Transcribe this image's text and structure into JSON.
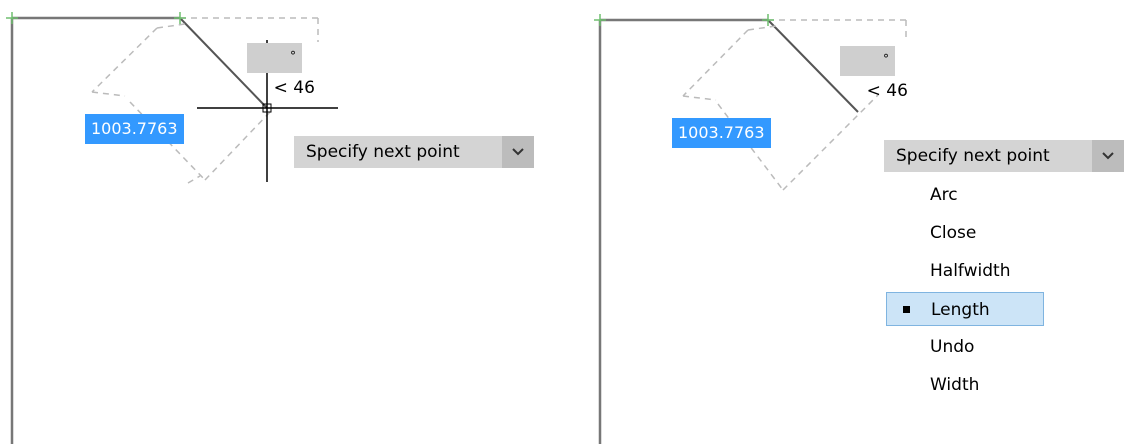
{
  "left_panel": {
    "angle_value": "< 46",
    "degree_symbol": "°",
    "distance_value": "1003.7763",
    "prompt_text": "Specify next point",
    "dropdown_icon": "chevron-down-icon"
  },
  "right_panel": {
    "angle_value": "< 46",
    "degree_symbol": "°",
    "distance_value": "1003.7763",
    "prompt_text": "Specify next point",
    "dropdown_icon": "chevron-down-icon",
    "options": [
      {
        "label": "Arc",
        "selected": false
      },
      {
        "label": "Close",
        "selected": false
      },
      {
        "label": "Halfwidth",
        "selected": false
      },
      {
        "label": "Length",
        "selected": true
      },
      {
        "label": "Undo",
        "selected": false
      },
      {
        "label": "Width",
        "selected": false
      }
    ]
  },
  "colors": {
    "distance_bg": "#3399ff",
    "prompt_bg": "#d4d4d4",
    "selected_bg": "#cce4f7",
    "vertex_marker": "#6fbf6f"
  }
}
